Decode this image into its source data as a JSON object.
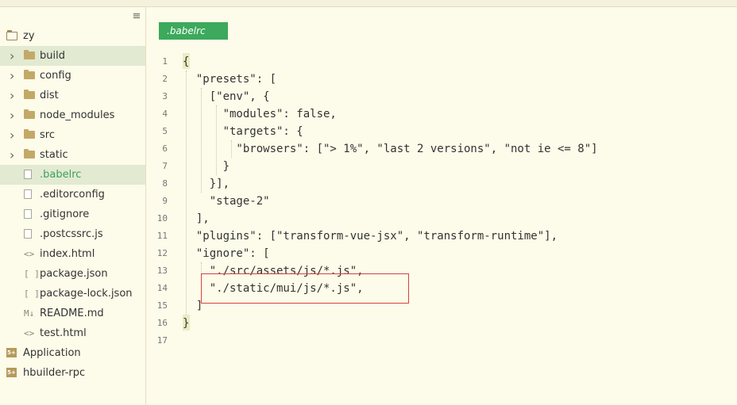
{
  "sidebar": {
    "menu_icon": "hamburger-menu-icon",
    "items": [
      {
        "label": "zy",
        "type": "project-root",
        "depth": 0
      },
      {
        "label": "build",
        "type": "folder",
        "depth": 1
      },
      {
        "label": "config",
        "type": "folder",
        "depth": 1
      },
      {
        "label": "dist",
        "type": "folder",
        "depth": 1
      },
      {
        "label": "node_modules",
        "type": "folder",
        "depth": 1
      },
      {
        "label": "src",
        "type": "folder",
        "depth": 1
      },
      {
        "label": "static",
        "type": "folder",
        "depth": 1
      },
      {
        "label": ".babelrc",
        "type": "file",
        "depth": 1
      },
      {
        "label": ".editorconfig",
        "type": "file",
        "depth": 1
      },
      {
        "label": ".gitignore",
        "type": "file",
        "depth": 1
      },
      {
        "label": ".postcssrc.js",
        "type": "file",
        "depth": 1
      },
      {
        "label": "index.html",
        "type": "html",
        "depth": 1,
        "glyph": "<>"
      },
      {
        "label": "package.json",
        "type": "json",
        "depth": 1,
        "glyph": "[ ]"
      },
      {
        "label": "package-lock.json",
        "type": "json",
        "depth": 1,
        "glyph": "[ ]"
      },
      {
        "label": "README.md",
        "type": "md",
        "depth": 1,
        "glyph": "M↓"
      },
      {
        "label": "test.html",
        "type": "html",
        "depth": 1,
        "glyph": "<>"
      },
      {
        "label": "Application",
        "type": "project",
        "depth": 0,
        "glyph": "5+"
      },
      {
        "label": "hbuilder-rpc",
        "type": "project",
        "depth": 0,
        "glyph": "5+"
      }
    ]
  },
  "editor": {
    "tab_label": ".babelrc",
    "lines": [
      {
        "n": "1",
        "text": "{"
      },
      {
        "n": "2",
        "text": "  \"presets\": ["
      },
      {
        "n": "3",
        "text": "    [\"env\", {"
      },
      {
        "n": "4",
        "text": "      \"modules\": false,"
      },
      {
        "n": "5",
        "text": "      \"targets\": {"
      },
      {
        "n": "6",
        "text": "        \"browsers\": [\"> 1%\", \"last 2 versions\", \"not ie <= 8\"]"
      },
      {
        "n": "7",
        "text": "      }"
      },
      {
        "n": "8",
        "text": "    }],"
      },
      {
        "n": "9",
        "text": "    \"stage-2\""
      },
      {
        "n": "10",
        "text": "  ],"
      },
      {
        "n": "11",
        "text": "  \"plugins\": [\"transform-vue-jsx\", \"transform-runtime\"],"
      },
      {
        "n": "12",
        "text": "  \"ignore\": ["
      },
      {
        "n": "13",
        "text": "    \"./src/assets/js/*.js\","
      },
      {
        "n": "14",
        "text": "    \"./static/mui/js/*.js\","
      },
      {
        "n": "15",
        "text": "  ]"
      },
      {
        "n": "16",
        "text": "}"
      },
      {
        "n": "17",
        "text": ""
      }
    ]
  },
  "colors": {
    "background": "#fdfbe9",
    "tab_active": "#3ca95c",
    "selected_row": "#e2ead2",
    "highlight_border": "#d9423c"
  }
}
